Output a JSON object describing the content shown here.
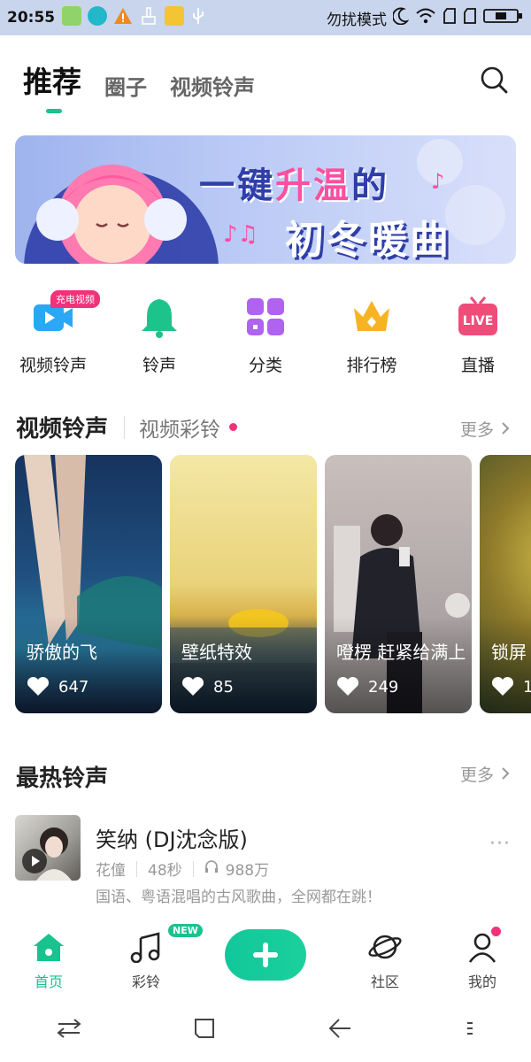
{
  "status_bar": {
    "time": "20:55",
    "dnd_text": "勿扰模式"
  },
  "tabs": [
    {
      "label": "推荐",
      "active": true
    },
    {
      "label": "圈子",
      "active": false
    },
    {
      "label": "视频铃声",
      "active": false
    }
  ],
  "banner": {
    "line1_a": "一键",
    "line1_b": "升温",
    "line1_c": "的",
    "line2": "初冬暖曲"
  },
  "quick_actions": [
    {
      "label": "视频铃声",
      "icon": "video-ringtone-icon",
      "badge": "充电视频"
    },
    {
      "label": "铃声",
      "icon": "bell-icon"
    },
    {
      "label": "分类",
      "icon": "category-icon"
    },
    {
      "label": "排行榜",
      "icon": "crown-icon"
    },
    {
      "label": "直播",
      "icon": "live-tv-icon",
      "icon_text": "LIVE"
    }
  ],
  "video_section": {
    "title": "视频铃声",
    "sub_tab": "视频彩铃",
    "more": "更多"
  },
  "video_cards": [
    {
      "title": "骄傲的飞",
      "likes": "647"
    },
    {
      "title": "壁纸特效",
      "likes": "85"
    },
    {
      "title": "噔楞 赶紧给满上",
      "likes": "249"
    },
    {
      "title": "锁屏",
      "likes": "1"
    }
  ],
  "hot_section": {
    "title": "最热铃声",
    "more": "更多"
  },
  "hot_songs": [
    {
      "title": "笑纳 (DJ沈念版)",
      "artist": "花僮",
      "duration": "48秒",
      "plays": "988万",
      "desc": "国语、粤语混唱的古风歌曲，全网都在跳！"
    }
  ],
  "bottom_nav": [
    {
      "label": "首页",
      "icon": "home-icon",
      "active": true
    },
    {
      "label": "彩铃",
      "icon": "music-note-icon",
      "badge": "NEW"
    },
    {
      "label": "",
      "icon": "add-icon"
    },
    {
      "label": "社区",
      "icon": "planet-icon"
    },
    {
      "label": "我的",
      "icon": "profile-icon"
    }
  ],
  "colors": {
    "accent": "#19c28e",
    "pink": "#f0327a",
    "status_bar_bg": "#c9d5ec"
  }
}
